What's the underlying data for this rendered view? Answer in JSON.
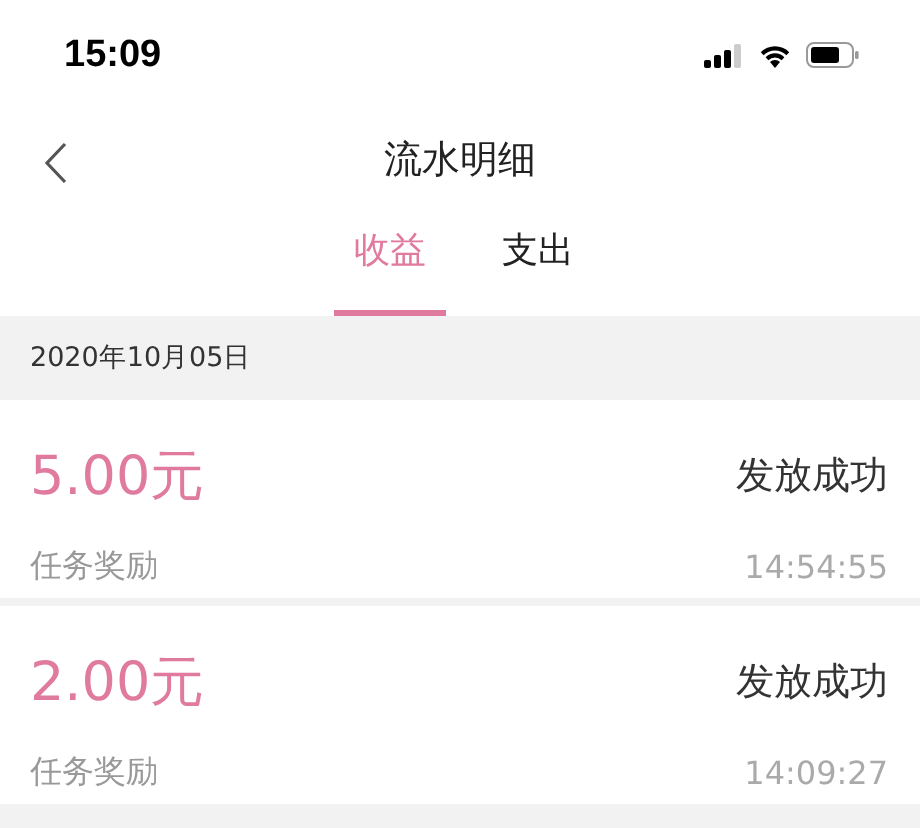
{
  "status_bar": {
    "time": "15:09"
  },
  "nav": {
    "title": "流水明细"
  },
  "tabs": [
    {
      "label": "收益",
      "selected": true
    },
    {
      "label": "支出",
      "selected": false
    }
  ],
  "groups": [
    {
      "date": "2020年10月05日",
      "entries": [
        {
          "amount": "5.00元",
          "status": "发放成功",
          "description": "任务奖励",
          "time": "14:54:55"
        },
        {
          "amount": "2.00元",
          "status": "发放成功",
          "description": "任务奖励",
          "time": "14:09:27"
        }
      ]
    }
  ]
}
